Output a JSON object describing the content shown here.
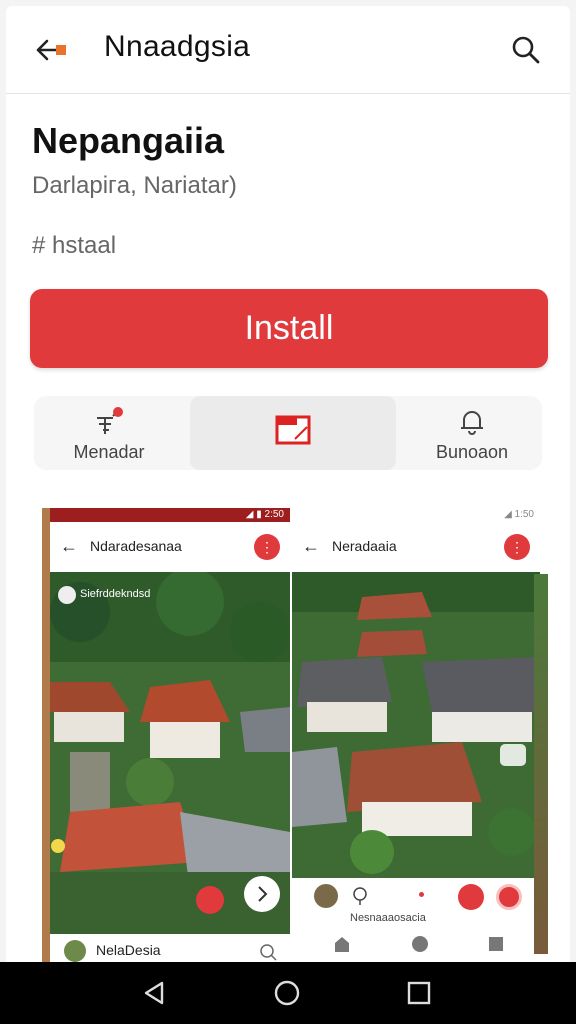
{
  "appbar": {
    "title": "Nnaadgsia",
    "back_icon": "back-arrow-icon",
    "search_icon": "search-icon"
  },
  "app": {
    "name": "Nepangaiia",
    "developer": "Darlapiгa, Nariatar)",
    "category": "# hstaal",
    "install_label": "Install",
    "accent": "#e03a3c"
  },
  "actions": [
    {
      "label": "Menadar",
      "icon": "broadcast-icon"
    },
    {
      "label": "",
      "icon": "calendar-icon"
    },
    {
      "label": "Bunoaon",
      "icon": "bell-icon"
    }
  ],
  "screenshots": [
    {
      "status": "◢ ▮ 2:50",
      "title": "Ndaradesanaa",
      "overlay_caption": "Siefrddekndsd",
      "footer_title": "NelaDesia"
    },
    {
      "status": "◢ 1:50",
      "title": "Neradaaia",
      "footer_caption": "Nesnaaaosacia"
    }
  ],
  "navbar": {
    "back_icon": "nav-back-icon",
    "home_icon": "nav-home-icon",
    "recents_icon": "nav-recents-icon"
  }
}
